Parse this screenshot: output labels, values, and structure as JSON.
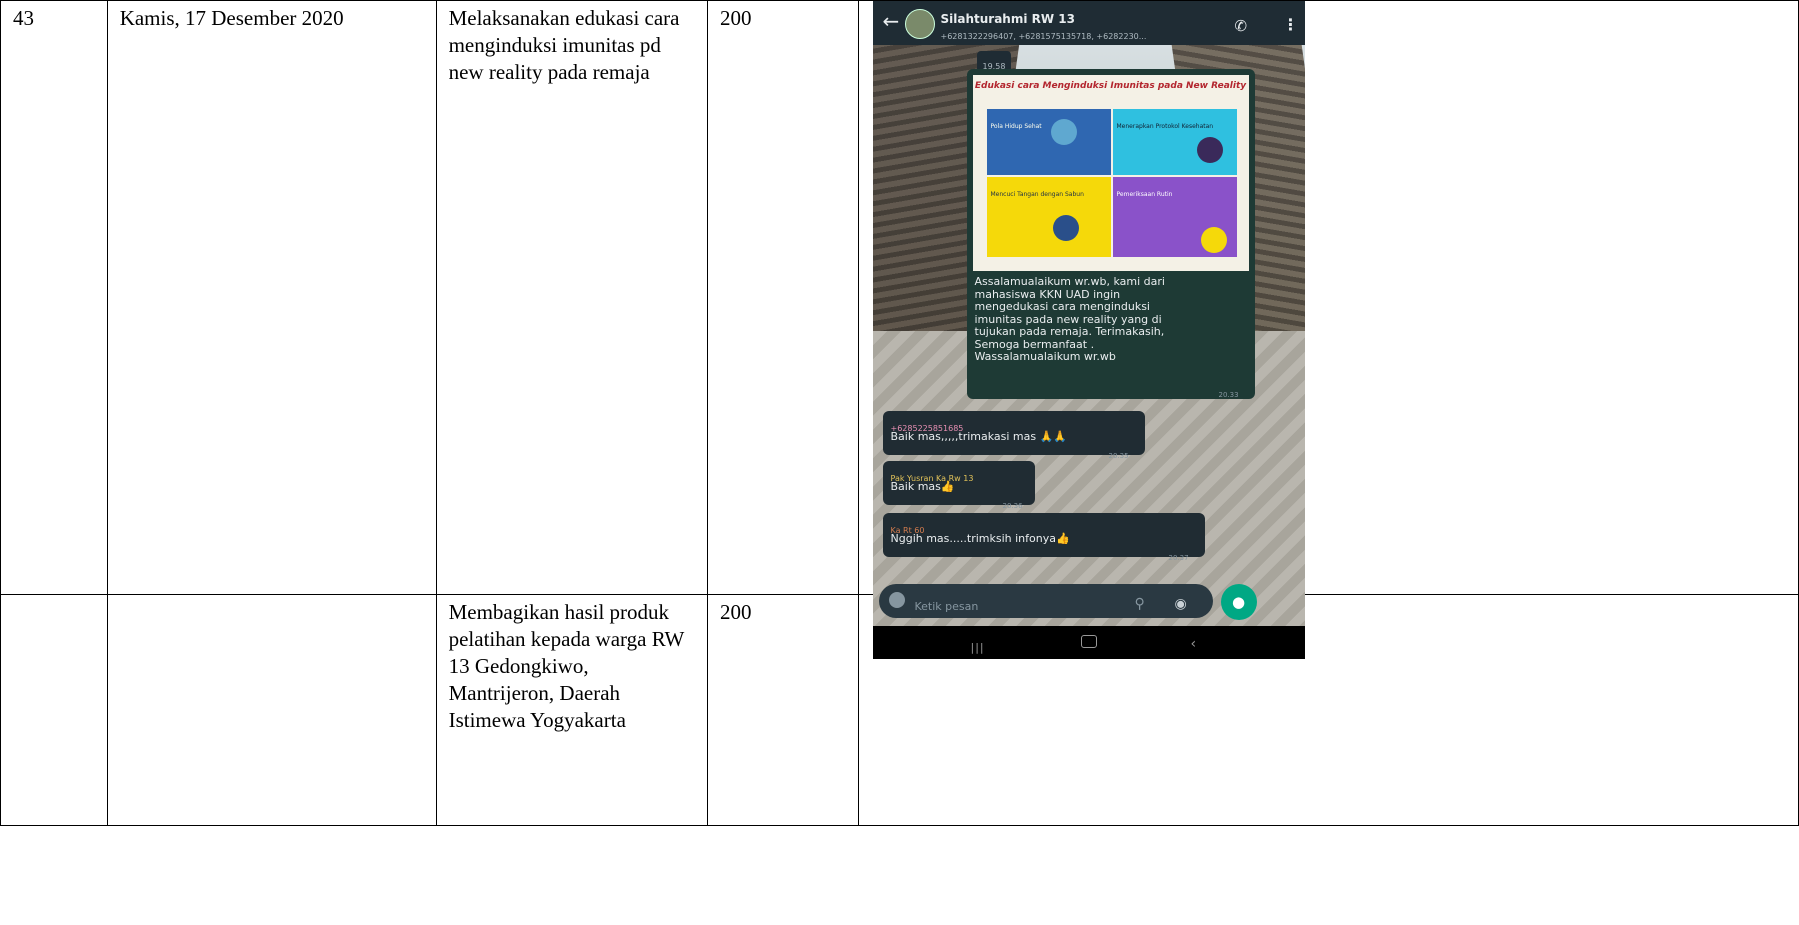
{
  "rows": [
    {
      "no": "43",
      "date": "Kamis, 17 Desember 2020",
      "activity": "Melaksanakan edukasi cara menginduksi imunitas pd new reality pada remaja",
      "value": "200"
    },
    {
      "no": "",
      "date": "",
      "activity": "Membagikan hasil produk pelatihan kepada warga RW 13 Gedongkiwo, Mantrijeron, Daerah Istimewa Yogyakarta",
      "value": "200"
    }
  ],
  "screenshot": {
    "chat_title": "Silahturahmi RW 13",
    "chat_subtitle": "+6281322296407, +6281575135718, +6282230...",
    "date_chip": "19.58",
    "poster_title": "Edukasi cara Menginduksi Imunitas pada New Reality",
    "poster_panels": [
      "Pola Hidup Sehat",
      "Menerapkan Protokol Kesehatan",
      "Mencuci Tangan dengan Sabun",
      "Pemeriksaan Rutin"
    ],
    "message_text": [
      "Assalamualaikum wr.wb, kami dari",
      "mahasiswa KKN UAD ingin",
      "mengedukasi cara menginduksi",
      "imunitas pada new reality yang di",
      "tujukan pada remaja. Terimakasih,",
      "Semoga bermanfaat .",
      "Wassalamualaikum wr.wb"
    ],
    "message_time": "20.33",
    "replies": [
      {
        "sender": "+6285225851685",
        "text": "Baik mas,,,,,trimakasi mas 🙏🙏",
        "time": "20.35"
      },
      {
        "sender": "Pak Yusran Ka Rw 13",
        "text": "Baik mas👍",
        "time": "20.36"
      },
      {
        "sender": "Ka Rt 60",
        "text": "Nggih mas.....trimksih infonya👍",
        "time": "20.37"
      }
    ],
    "input_placeholder": "Ketik pesan",
    "accent_color": "#00a884",
    "header_color": "#1f2c34"
  }
}
